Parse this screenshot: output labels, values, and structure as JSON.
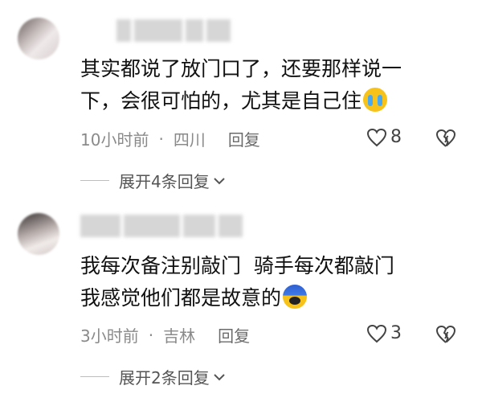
{
  "comments": [
    {
      "content_line1": "其实都说了放门口了，还要那样说一",
      "content_line2": "下，会很可怕的，尤其是自己住",
      "emoji_icon": "loudly-crying-face-icon",
      "time": "10小时前",
      "separator": "·",
      "location": "四川",
      "reply_label": "回复",
      "likes": "8",
      "expand_label": "展开4条回复"
    },
    {
      "content_line1": "我每次备注别敲门  骑手每次都敲门",
      "content_line2": "我感觉他们都是故意的",
      "emoji_icon": "face-screaming-in-fear-icon",
      "time": "3小时前",
      "separator": "·",
      "location": "吉林",
      "reply_label": "回复",
      "likes": "3",
      "expand_label": "展开2条回复"
    }
  ],
  "colors": {
    "meta_text": "#8a8a8a",
    "body_text": "#111111"
  }
}
